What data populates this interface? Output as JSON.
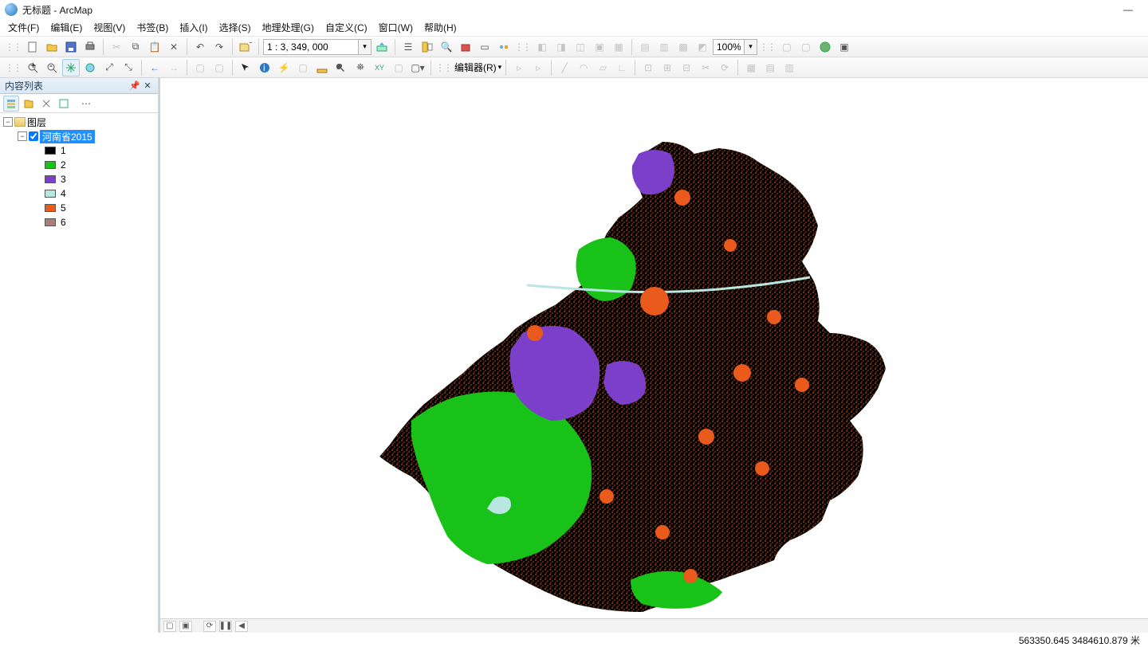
{
  "window": {
    "title": "无标题 - ArcMap",
    "minimize": "—"
  },
  "menu": {
    "file": "文件(F)",
    "edit": "编辑(E)",
    "view": "视图(V)",
    "bookmark": "书签(B)",
    "insert": "插入(I)",
    "select": "选择(S)",
    "geoprocess": "地理处理(G)",
    "customize": "自定义(C)",
    "window": "窗口(W)",
    "help": "帮助(H)"
  },
  "toolbar1": {
    "scale": "1 : 3, 349, 000",
    "zoom": "100%"
  },
  "toolbar2": {
    "editor": "编辑器(R)"
  },
  "toc": {
    "title": "内容列表",
    "root": "图层",
    "layer": "河南省2015",
    "classes": [
      {
        "label": "1",
        "color": "#000000"
      },
      {
        "label": "2",
        "color": "#18c218"
      },
      {
        "label": "3",
        "color": "#7b3fc9"
      },
      {
        "label": "4",
        "color": "#b9e6e0"
      },
      {
        "label": "5",
        "color": "#ea5a1c"
      },
      {
        "label": "6",
        "color": "#a87e7e"
      }
    ]
  },
  "status": {
    "coords": "563350.645  3484610.879 米"
  }
}
